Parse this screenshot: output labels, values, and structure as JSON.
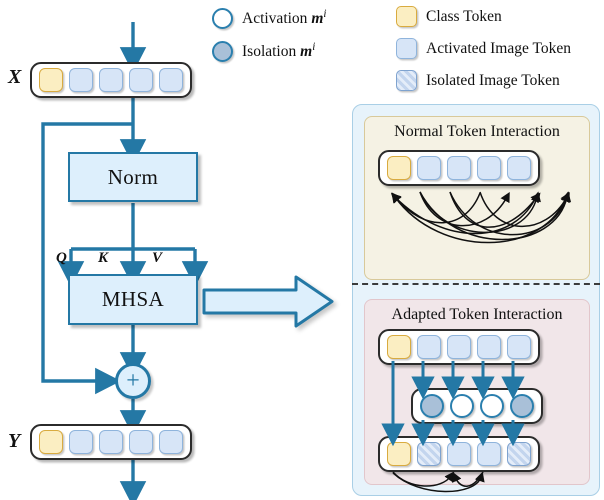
{
  "legend": {
    "items": [
      {
        "id": "activation",
        "icon": "circle-outline-icon",
        "label": "Activation",
        "symbol": "m",
        "sup": "i"
      },
      {
        "id": "isolation",
        "icon": "circle-filled-icon",
        "label": "Isolation",
        "symbol": "m",
        "sup": "i"
      },
      {
        "id": "class_token",
        "icon": "yellow-square-icon",
        "label": "Class Token",
        "symbol": "",
        "sup": ""
      },
      {
        "id": "activated_image_token",
        "icon": "blue-square-icon",
        "label": "Activated Image Token",
        "symbol": "",
        "sup": ""
      },
      {
        "id": "isolated_image_token",
        "icon": "hatched-square-icon",
        "label": "Isolated Image Token",
        "symbol": "",
        "sup": ""
      }
    ]
  },
  "flow": {
    "input_label": "X",
    "output_label": "Y",
    "norm_label": "Norm",
    "mhsa_label": "MHSA",
    "qkv": [
      "Q",
      "K",
      "V"
    ],
    "add_symbol": "+",
    "input_tokens": [
      "class",
      "image",
      "image",
      "image",
      "image"
    ],
    "output_tokens": [
      "class",
      "image",
      "image",
      "image",
      "image"
    ]
  },
  "right_panel": {
    "normal": {
      "title": "Normal Token Interaction",
      "tokens": [
        "class",
        "image",
        "image",
        "image",
        "image"
      ]
    },
    "adapted": {
      "title": "Adapted Token Interaction",
      "input_tokens": [
        "class",
        "image",
        "image",
        "image",
        "image"
      ],
      "mask_circles": [
        "isolation",
        "activation",
        "activation",
        "isolation"
      ],
      "output_tokens": [
        "class",
        "isolated",
        "image",
        "image",
        "isolated"
      ]
    }
  },
  "colors": {
    "accent_blue": "#2478a5",
    "token_blue_fill": "#d7e5f7",
    "token_blue_border": "#8fb4dc",
    "class_fill": "#fbeec2",
    "class_border": "#d9ab3f",
    "panel_bg": "#e7f3fb",
    "normal_bg": "#f5f2e4",
    "adapted_bg": "#f1e6e9",
    "arc_black": "#111111",
    "circle_fill": "#a9c0d8"
  }
}
